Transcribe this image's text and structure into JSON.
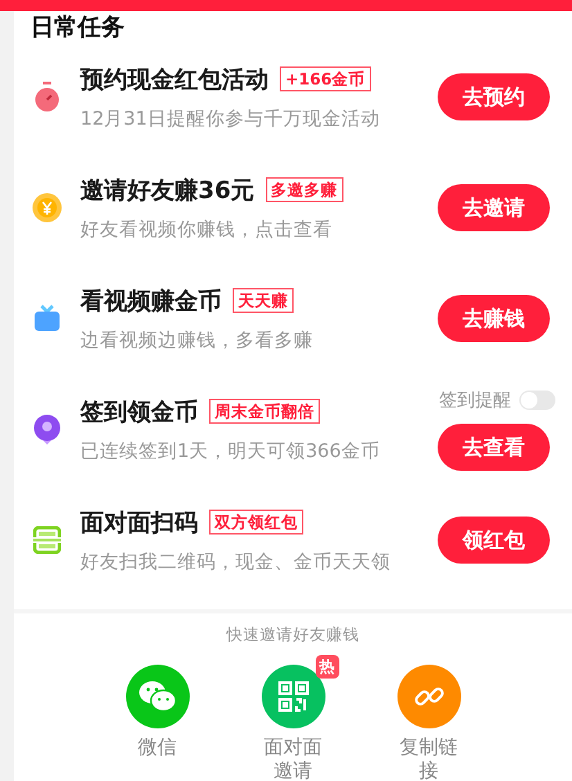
{
  "section_title": "日常任务",
  "tasks": [
    {
      "title": "预约现金红包活动",
      "tag": "+166金币",
      "subtitle": "12月31日提醒你参与千万现金活动",
      "button": "去预约"
    },
    {
      "title": "邀请好友赚36元",
      "tag": "多邀多赚",
      "subtitle": "好友看视频你赚钱，点击查看",
      "button": "去邀请"
    },
    {
      "title": "看视频赚金币",
      "tag": "天天赚",
      "subtitle": "边看视频边赚钱，多看多赚",
      "button": "去赚钱"
    },
    {
      "title": "签到领金币",
      "tag": "周末金币翻倍",
      "subtitle": "已连续签到1天，明天可领366金币",
      "button": "去查看",
      "reminder": {
        "label": "签到提醒",
        "on": false
      }
    },
    {
      "title": "面对面扫码",
      "tag": "双方领红包",
      "subtitle": "好友扫我二维码，现金、金币天天领",
      "button": "领红包"
    }
  ],
  "share": {
    "title": "快速邀请好友赚钱",
    "items": [
      {
        "label": "微信",
        "color": "#09c618"
      },
      {
        "label": "面对面邀请",
        "color": "#07c160",
        "badge": "热"
      },
      {
        "label": "复制链接",
        "color": "#fe8a00"
      }
    ]
  }
}
